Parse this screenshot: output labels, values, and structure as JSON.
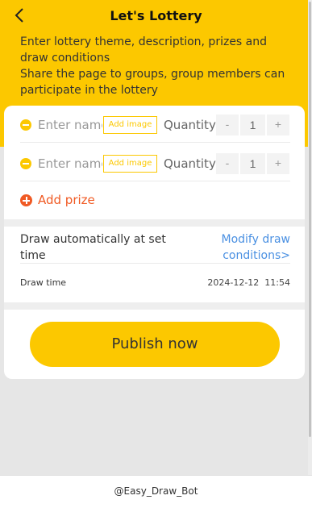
{
  "header": {
    "title": "Let's Lottery",
    "intro_line1": "Enter lottery theme, description, prizes and draw conditions",
    "intro_line2": "Share the page to groups, group members can participate in the lottery",
    "accent_color": "#fcc800"
  },
  "prizes": [
    {
      "name_placeholder": "Enter name",
      "name_value": "",
      "add_image_label": "Add image",
      "quantity_label": "Quantity",
      "minus": "-",
      "plus": "+",
      "quantity": "1"
    },
    {
      "name_placeholder": "Enter name",
      "name_value": "",
      "add_image_label": "Add image",
      "quantity_label": "Quantity",
      "minus": "-",
      "plus": "+",
      "quantity": "1"
    }
  ],
  "add_prize_label": "Add prize",
  "draw": {
    "auto_label": "Draw automatically at set time",
    "modify_link": "Modify draw conditions>",
    "time_label": "Draw time",
    "time_value": "2024-12-12  11:54"
  },
  "publish_label": "Publish now",
  "footer": {
    "bot_name": "@Easy_Draw_Bot"
  },
  "icons": {
    "back": "chevron-left-icon",
    "remove_prize": "minus-circle-icon",
    "add_prize": "plus-circle-icon"
  },
  "colors": {
    "brand": "#fcc800",
    "link": "#4a90e2",
    "add_prize": "#f05a24"
  }
}
